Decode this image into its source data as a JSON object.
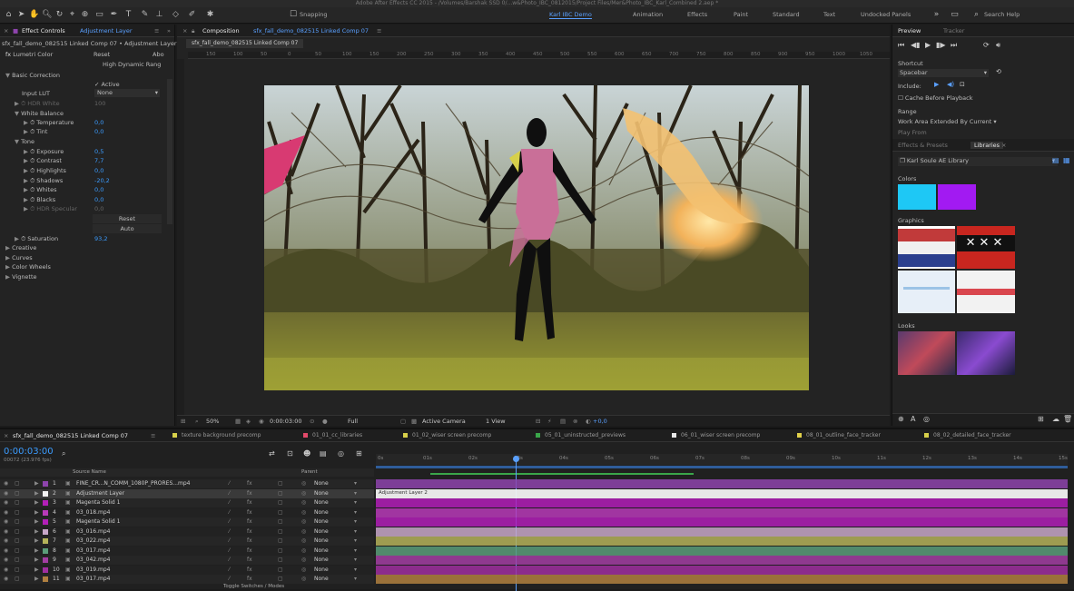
{
  "window": {
    "title": "Adobe After Effects CC 2015 - /Volumes/Barshak SSD 0/...w&Photo_IBC_0812015/Project Files/Mer&Photo_IBC_Karl_Combined 2.aep *"
  },
  "toolbar": {
    "snapping_label": "Snapping",
    "workspaces": [
      "Karl IBC Demo",
      "Animation",
      "Effects",
      "Paint",
      "Standard",
      "Text",
      "Undocked Panels"
    ],
    "search_placeholder": "Search Help"
  },
  "effect_controls": {
    "tab_label": "Effect Controls",
    "tab_layer": "Adjustment Layer",
    "comp_path": "sfx_fall_demo_082515 Linked Comp 07 • Adjustment Layer",
    "effect_name": "Lumetri Color",
    "reset_label": "Reset",
    "about_label": "Abo",
    "hdr_label": "High Dynamic Rang",
    "basic_correction": "Basic Correction",
    "active_label": "Active",
    "input_lut_label": "Input LUT",
    "input_lut_value": "None",
    "hdr_white_label": "HDR White",
    "hdr_white_value": "100",
    "white_balance": "White Balance",
    "temperature_label": "Temperature",
    "temperature_value": "0,0",
    "tint_label": "Tint",
    "tint_value": "0,0",
    "tone_label": "Tone",
    "exposure_label": "Exposure",
    "exposure_value": "0,5",
    "contrast_label": "Contrast",
    "contrast_value": "7,7",
    "highlights_label": "Highlights",
    "highlights_value": "0,0",
    "shadows_label": "Shadows",
    "shadows_value": "-20,2",
    "whites_label": "Whites",
    "whites_value": "0,0",
    "blacks_label": "Blacks",
    "blacks_value": "0,0",
    "hdr_specular_label": "HDR Specular",
    "hdr_specular_value": "0,0",
    "reset_btn": "Reset",
    "auto_btn": "Auto",
    "saturation_label": "Saturation",
    "saturation_value": "93,2",
    "sections": [
      "Creative",
      "Curves",
      "Color Wheels",
      "Vignette"
    ]
  },
  "composition": {
    "tab_label": "Composition",
    "tab_name": "sfx_fall_demo_082515 Linked Comp 07",
    "sub_tab": "sfx_fall_demo_082515 Linked Comp 07",
    "ruler_ticks": [
      "150",
      "100",
      "50",
      "0",
      "50",
      "100",
      "150",
      "200",
      "250",
      "300",
      "350",
      "400",
      "450",
      "500",
      "550",
      "600",
      "650",
      "700",
      "750",
      "800",
      "850",
      "900",
      "950",
      "1000",
      "1050"
    ],
    "footer": {
      "zoom": "50%",
      "timecode": "0:00:03:00",
      "resolution": "Full",
      "camera": "Active Camera",
      "view": "1 View",
      "exposure": "+0,0"
    }
  },
  "right_panel": {
    "preview_tab": "Preview",
    "tracker_tab": "Tracker",
    "shortcut_label": "Shortcut",
    "shortcut_value": "Spacebar",
    "include_label": "Include:",
    "cache_label": "Cache Before Playback",
    "range_label": "Range",
    "range_value": "Work Area Extended By Current",
    "play_from_label": "Play From",
    "effects_tab": "Effects & Presets",
    "libraries_tab": "Libraries",
    "library_name": "Karl Soule AE Library",
    "colors_label": "Colors",
    "colors": [
      "#1ec8f5",
      "#a21af2"
    ],
    "graphics_label": "Graphics",
    "looks_label": "Looks"
  },
  "timeline": {
    "comp_tab": "sfx_fall_demo_082515 Linked Comp 07",
    "timecode": "0:00:03:00",
    "timecode_sub": "00072 (23.976 fps)",
    "other_tabs": [
      "texture background precomp",
      "01_01_cc_libraries",
      "01_02_wiser screen precomp",
      "05_01_uninstructed_previews",
      "06_01_wiser screen precomp",
      "08_01_outline_face_tracker",
      "08_02_detailed_face_tracker"
    ],
    "col_source": "Source Name",
    "col_parent": "Parent",
    "ruler": [
      "0s",
      "01s",
      "02s",
      "03s",
      "04s",
      "05s",
      "06s",
      "07s",
      "08s",
      "09s",
      "10s",
      "11s",
      "12s",
      "13s",
      "14s",
      "15s"
    ],
    "toggle_label": "Toggle Switches / Modes",
    "layers": [
      {
        "num": "1",
        "name": "FINE_CR...N_COMM_1080P_PRORES...mp4",
        "parent": "None",
        "color": "#8e44ad"
      },
      {
        "num": "2",
        "name": "Adjustment Layer",
        "parent": "None",
        "color": "#f2f2f2"
      },
      {
        "num": "3",
        "name": "Magenta Solid 1",
        "parent": "None",
        "color": "#b31fb8"
      },
      {
        "num": "4",
        "name": "03_018.mp4",
        "parent": "None",
        "color": "#b93ab9"
      },
      {
        "num": "5",
        "name": "Magenta Solid 1",
        "parent": "None",
        "color": "#b31fb8"
      },
      {
        "num": "6",
        "name": "03_016.mp4",
        "parent": "None",
        "color": "#c9a8c9"
      },
      {
        "num": "7",
        "name": "03_022.mp4",
        "parent": "None",
        "color": "#b5b35a"
      },
      {
        "num": "8",
        "name": "03_017.mp4",
        "parent": "None",
        "color": "#5b9e7a"
      },
      {
        "num": "9",
        "name": "03_042.mp4",
        "parent": "None",
        "color": "#a33ea3"
      },
      {
        "num": "10",
        "name": "03_019.mp4",
        "parent": "None",
        "color": "#a02fa0"
      },
      {
        "num": "11",
        "name": "03_017.mp4",
        "parent": "None",
        "color": "#b08040"
      }
    ],
    "bar_label": "Adjustment Layer 2"
  }
}
